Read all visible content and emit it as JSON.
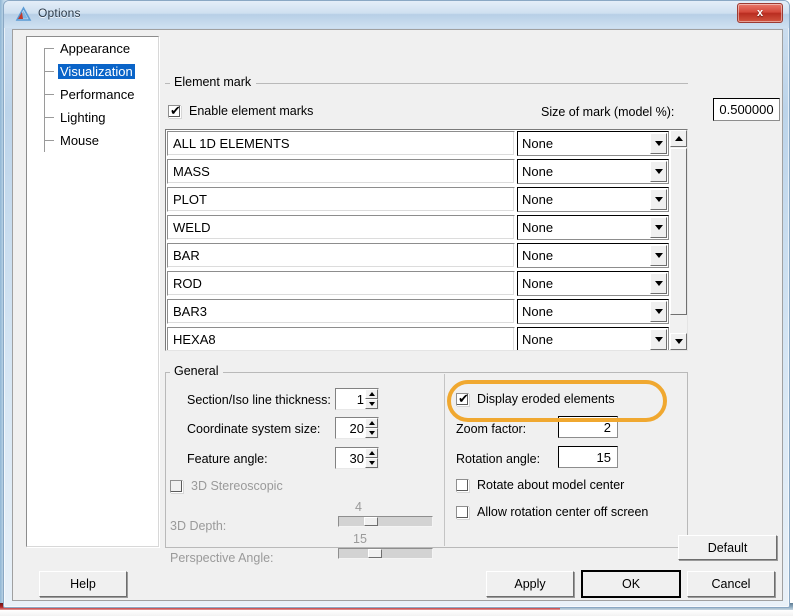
{
  "window": {
    "title": "Options",
    "icon": "app-triangle-icon",
    "close_label": "x"
  },
  "sidebar": {
    "items": [
      {
        "label": "Appearance",
        "selected": false
      },
      {
        "label": "Visualization",
        "selected": true
      },
      {
        "label": "Performance",
        "selected": false
      },
      {
        "label": "Lighting",
        "selected": false
      },
      {
        "label": "Mouse",
        "selected": false
      }
    ]
  },
  "element_mark": {
    "group_title": "Element mark",
    "enable_label": "Enable element marks",
    "enable_checked": true,
    "size_label": "Size of mark (model %):",
    "size_value": "0.500000",
    "rows": [
      {
        "name": "ALL 1D ELEMENTS",
        "mark": "None"
      },
      {
        "name": "MASS",
        "mark": "None"
      },
      {
        "name": "PLOT",
        "mark": "None"
      },
      {
        "name": "WELD",
        "mark": "None"
      },
      {
        "name": "BAR",
        "mark": "None"
      },
      {
        "name": "ROD",
        "mark": "None"
      },
      {
        "name": "BAR3",
        "mark": "None"
      },
      {
        "name": "HEXA8",
        "mark": "None"
      }
    ]
  },
  "general": {
    "group_title": "General",
    "section_iso_label": "Section/Iso line thickness:",
    "section_iso_value": "1",
    "coord_size_label": "Coordinate system size:",
    "coord_size_value": "20",
    "feature_angle_label": "Feature angle:",
    "feature_angle_value": "30",
    "stereoscopic_label": "3D Stereoscopic",
    "stereoscopic_checked": false,
    "depth_label": "3D Depth:",
    "depth_value": "4",
    "perspective_label": "Perspective Angle:",
    "perspective_value": "15",
    "display_eroded_label": "Display eroded elements",
    "display_eroded_checked": true,
    "zoom_factor_label": "Zoom factor:",
    "zoom_factor_value": "2",
    "rotation_angle_label": "Rotation angle:",
    "rotation_angle_value": "15",
    "rotate_center_label": "Rotate about model center",
    "rotate_center_checked": false,
    "allow_offscreen_label": "Allow rotation center off screen",
    "allow_offscreen_checked": false,
    "default_label": "Default"
  },
  "footer": {
    "help_label": "Help",
    "apply_label": "Apply",
    "ok_label": "OK",
    "cancel_label": "Cancel"
  },
  "annotation": {
    "highlight_color": "#f0a830",
    "highlight_target": "display-eroded-elements-checkbox"
  }
}
